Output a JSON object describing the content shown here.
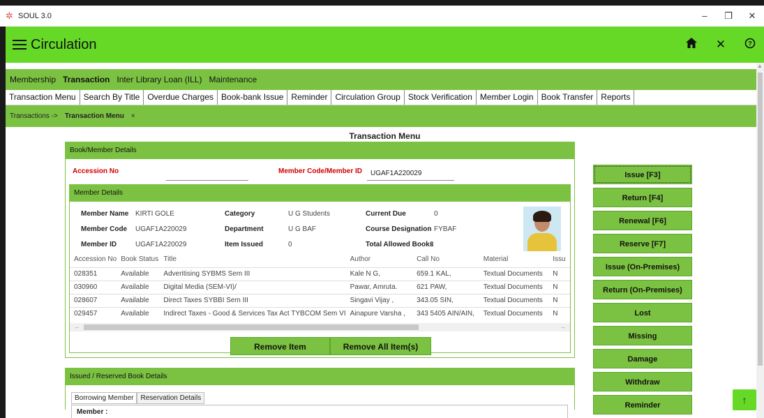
{
  "window": {
    "app_name": "SOUL 3.0",
    "minimize": "–",
    "restore": "❐",
    "close": "✕"
  },
  "appbar": {
    "title": "Circulation",
    "home_icon": "⌂",
    "close_icon": "✕",
    "help_icon": "?"
  },
  "main_menu": [
    "Membership",
    "Transaction",
    "Inter Library Loan (ILL)",
    "Maintenance"
  ],
  "tab_menu": [
    "Transaction Menu",
    "Search By Title",
    "Overdue Charges",
    "Book-bank Issue",
    "Reminder",
    "Circulation Group",
    "Stock Verification",
    "Member Login",
    "Book Transfer",
    "Reports"
  ],
  "breadcrumb": {
    "parent": "Transactions ->",
    "current": "Transaction Menu",
    "close": "×"
  },
  "page_title": "Transaction Menu",
  "book_member": {
    "header": "Book/Member Details",
    "accession_label": "Accession No",
    "accession_value": "",
    "member_code_label": "Member Code/Member ID",
    "member_code_value": "UGAF1A220029"
  },
  "member_details": {
    "header": "Member Details",
    "member_name_label": "Member Name",
    "member_name": "KIRTI GOLE",
    "member_code_label": "Member Code",
    "member_code": "UGAF1A220029",
    "member_id_label": "Member ID",
    "member_id": "UGAF1A220029",
    "category_label": "Category",
    "category": "U G Students",
    "department_label": "Department",
    "department": "U G BAF",
    "item_issued_label": "Item Issued",
    "item_issued": "0",
    "current_due_label": "Current Due",
    "current_due": "0",
    "course_label": "Course Designation",
    "course": "FYBAF",
    "total_allowed_label": "Total Allowed Books",
    "total_allowed": "2"
  },
  "items_table": {
    "columns": [
      "Accession No",
      "Book Status",
      "Title",
      "Author",
      "Call No",
      "Material",
      "Issu"
    ],
    "rows": [
      [
        "028351",
        "Available",
        "Adveritising SYBMS Sem III",
        "Kale N G,",
        "659.1 KAL,",
        "Textual Documents",
        "N"
      ],
      [
        "030960",
        "Available",
        "Digital Media (SEM-VI)/",
        "Pawar, Amruta.",
        "621 PAW,",
        "Textual Documents",
        "N"
      ],
      [
        "028607",
        "Available",
        "Direct Taxes SYBBI Sem III",
        "Singavi Vijay ,",
        "343.05 SIN,",
        "Textual Documents",
        "N"
      ],
      [
        "029457",
        "Available",
        "Indirect Taxes - Good & Services Tax Act TYBCOM Sem VI",
        "Ainapure Varsha ,",
        "343 5405 AIN/AIN,",
        "Textual Documents",
        "N"
      ]
    ]
  },
  "buttons": {
    "remove_item": "Remove Item",
    "remove_all": "Remove All Item(s)"
  },
  "issued": {
    "header": "Issued / Reserved Book Details",
    "tab_borrowing": "Borrowing Member",
    "tab_reservation": "Reservation Details",
    "member_label": "Member :"
  },
  "actions": [
    "Issue [F3]",
    "Return [F4]",
    "Renewal [F6]",
    "Reserve [F7]",
    "Issue (On-Premises)",
    "Return (On-Premises)",
    "Lost",
    "Missing",
    "Damage",
    "Withdraw",
    "Reminder"
  ],
  "scroll_top_icon": "↑"
}
